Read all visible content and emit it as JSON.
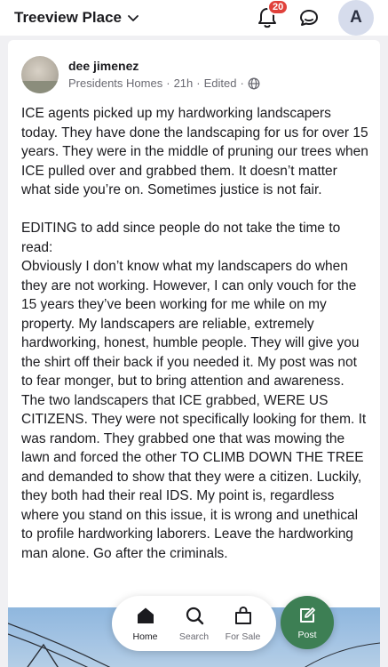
{
  "header": {
    "neighborhood": "Treeview Place",
    "notification_count": "20",
    "avatar_initial": "A"
  },
  "post": {
    "author_name": "dee jimenez",
    "neighborhood": "Presidents Homes",
    "age": "21h",
    "edited_label": "Edited",
    "sep": "·",
    "paragraph_1": "ICE agents picked up my hardworking landscapers today. They have done the landscaping for us for over 15 years. They were in the middle of pruning our trees when ICE pulled over and grabbed them. It doesn’t matter what side you’re on. Sometimes justice is not fair.",
    "paragraph_2": "EDITING to add since people do not take the time to read:",
    "paragraph_3": "Obviously I don’t know what my landscapers do when they are not working. However, I can only vouch for the 15 years they’ve been working for me while on my property. My landscapers are reliable, extremely hardworking, honest, humble people. They will give you the shirt off their back if you needed it. My post was not to fear monger, but to bring attention and awareness. The two landscapers that ICE grabbed, WERE US CITIZENS. They were not specifically looking for them. It was random. They grabbed one that was mowing the lawn and forced the other TO CLIMB DOWN THE TREE and demanded to show that they were a citizen. Luckily, they both had their real IDS. My point is, regardless where you stand on this issue, it is wrong and unethical to profile hardworking laborers. Leave the hardworking man alone. Go after the criminals."
  },
  "nav": {
    "home": "Home",
    "search": "Search",
    "for_sale": "For Sale",
    "post": "Post"
  },
  "colors": {
    "accent_green": "#3d7f54",
    "badge_red": "#e0413b"
  },
  "icons": [
    "chevron-down-icon",
    "bell-icon",
    "chat-icon",
    "globe-icon",
    "home-icon",
    "search-icon",
    "shopping-bag-icon",
    "edit-icon"
  ]
}
